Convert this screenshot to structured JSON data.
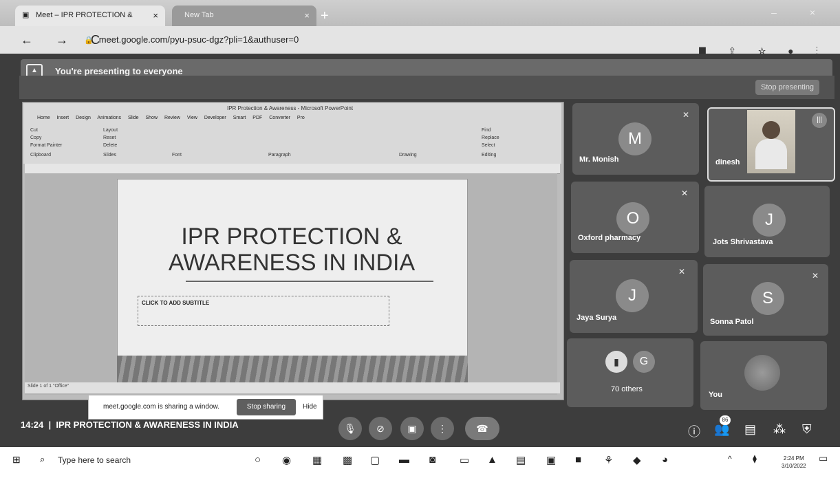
{
  "browser": {
    "tabs": [
      {
        "label": "Meet – IPR PROTECTION &",
        "close": "×"
      },
      {
        "label": "New Tab",
        "close": "×"
      }
    ],
    "new_tab": "+",
    "window_controls": "– ×",
    "nav": "← → C",
    "url": "meet.google.com/pyu-psuc-dgz?pli=1&authuser=0",
    "toolbar_icons": "⯀ ⇪ ☆ ● ⋮"
  },
  "meet": {
    "presenting_banner": "You're presenting to everyone",
    "stop_presenting": "Stop presenting",
    "meeting_time": "14:24",
    "meeting_title": "IPR PROTECTION & AWARENESS IN INDIA",
    "participant_count": "86",
    "participants": [
      {
        "name": "Mr. Monish",
        "initial": "M"
      },
      {
        "name": "dinesh",
        "initial": ""
      },
      {
        "name": "Oxford pharmacy",
        "initial": "O"
      },
      {
        "name": "Jots Shrivastava",
        "initial": "J"
      },
      {
        "name": "Jaya Surya",
        "initial": "J"
      },
      {
        "name": "Sonna Patol",
        "initial": "S"
      },
      {
        "name": "70 others",
        "initial": "G"
      },
      {
        "name": "You",
        "initial": ""
      }
    ]
  },
  "shared_window": {
    "window_title": "IPR Protection & Awareness - Microsoft PowerPoint",
    "ribbon_tabs": "Home Insert Design Animations Slide Show Review View Developer Smart PDF Converter Pro",
    "ribbon_groups": [
      "Cut",
      "Copy",
      "Format Painter",
      "Clipboard",
      "Layout",
      "Reset",
      "Delete",
      "Slides",
      "Font",
      "Paragraph",
      "Drawing",
      "Find",
      "Replace",
      "Select",
      "Editing"
    ],
    "slide_title_line1": "IPR PROTECTION &",
    "slide_title_line2": "AWARENESS IN INDIA",
    "slide_subtitle_placeholder": "CLICK TO ADD SUBTITLE",
    "status": "Slide 1 of 1   \"Office\""
  },
  "share_banner": {
    "text": "meet.google.com is sharing a window.",
    "stop_label": "Stop sharing",
    "hide_label": "Hide"
  },
  "taskbar": {
    "search_placeholder": "Type here to search",
    "time": "2:24 PM",
    "date": "3/10/2022"
  }
}
